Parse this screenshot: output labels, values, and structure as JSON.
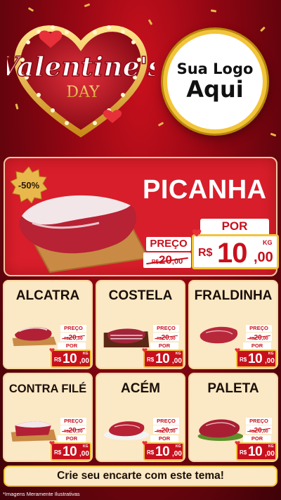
{
  "brand": {
    "heart_logo_text_1": "Valentine's",
    "heart_logo_text_2": "DAY",
    "logo_line1": "Sua Logo",
    "logo_line2": "Aqui"
  },
  "featured": {
    "name": "PICANHA",
    "discount": "-50%",
    "label_preco": "PREÇO",
    "old_price": {
      "currency": "R$",
      "int": "20",
      "dec": ",00"
    },
    "label_por": "POR",
    "new_price": {
      "currency": "R$",
      "int": "10",
      "dec": ",00",
      "unit": "KG"
    }
  },
  "products": [
    {
      "name": "ALCATRA",
      "label_preco": "PREÇO",
      "old": {
        "currency": "R$",
        "int": "20",
        "dec": ",00"
      },
      "label_por": "POR",
      "new": {
        "currency": "R$",
        "int": "10",
        "dec": ",00",
        "unit": "KG"
      }
    },
    {
      "name": "COSTELA",
      "label_preco": "PREÇO",
      "old": {
        "currency": "R$",
        "int": "20",
        "dec": ",00"
      },
      "label_por": "POR",
      "new": {
        "currency": "R$",
        "int": "10",
        "dec": ",00",
        "unit": "KG"
      }
    },
    {
      "name": "FRALDINHA",
      "label_preco": "PREÇO",
      "old": {
        "currency": "R$",
        "int": "20",
        "dec": ",00"
      },
      "label_por": "POR",
      "new": {
        "currency": "R$",
        "int": "10",
        "dec": ",00",
        "unit": "KG"
      }
    },
    {
      "name": "CONTRA FILÉ",
      "label_preco": "PREÇO",
      "old": {
        "currency": "R$",
        "int": "20",
        "dec": ",00"
      },
      "label_por": "POR",
      "new": {
        "currency": "R$",
        "int": "10",
        "dec": ",00",
        "unit": "KG"
      }
    },
    {
      "name": "ACÉM",
      "label_preco": "PREÇO",
      "old": {
        "currency": "R$",
        "int": "20",
        "dec": ",00"
      },
      "label_por": "POR",
      "new": {
        "currency": "R$",
        "int": "10",
        "dec": ",00",
        "unit": "KG"
      }
    },
    {
      "name": "PALETA",
      "label_preco": "PREÇO",
      "old": {
        "currency": "R$",
        "int": "20",
        "dec": ",00"
      },
      "label_por": "POR",
      "new": {
        "currency": "R$",
        "int": "10",
        "dec": ",00",
        "unit": "KG"
      }
    }
  ],
  "cta": "Crie seu encarte com este tema!",
  "disclaimer": "*Imagens Meramente Ilustrativas",
  "colors": {
    "red": "#c8101d",
    "gold": "#f2c43a",
    "cream": "#fbe8c4",
    "dark_red": "#3d0208"
  }
}
